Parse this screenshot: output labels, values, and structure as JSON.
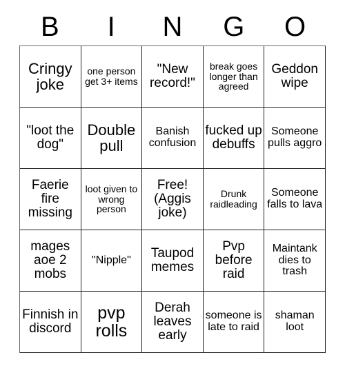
{
  "card": {
    "title": "BINGO",
    "headers": [
      "B",
      "I",
      "N",
      "G",
      "O"
    ],
    "rows": [
      [
        {
          "text": "Cringy joke",
          "size": "lg"
        },
        {
          "text": "one person get 3+ items",
          "size": "xs"
        },
        {
          "text": "\"New record!\"",
          "size": "md"
        },
        {
          "text": "break goes longer than agreed",
          "size": "xs"
        },
        {
          "text": "Geddon wipe",
          "size": "md"
        }
      ],
      [
        {
          "text": "\"loot the dog\"",
          "size": "md"
        },
        {
          "text": "Double pull",
          "size": "lg"
        },
        {
          "text": "Banish confusion",
          "size": "sm"
        },
        {
          "text": "fucked up debuffs",
          "size": "md"
        },
        {
          "text": "Someone pulls aggro",
          "size": "sm"
        }
      ],
      [
        {
          "text": "Faerie fire missing",
          "size": "md"
        },
        {
          "text": "loot given to wrong person",
          "size": "xs"
        },
        {
          "text": "Free! (Aggis joke)",
          "size": "md"
        },
        {
          "text": "Drunk raidleading",
          "size": "xs"
        },
        {
          "text": "Someone falls to lava",
          "size": "sm"
        }
      ],
      [
        {
          "text": "mages aoe 2 mobs",
          "size": "md"
        },
        {
          "text": "\"Nipple\"",
          "size": "sm"
        },
        {
          "text": "Taupod memes",
          "size": "md"
        },
        {
          "text": "Pvp before raid",
          "size": "md"
        },
        {
          "text": "Maintank dies to trash",
          "size": "sm"
        }
      ],
      [
        {
          "text": "Finnish in discord",
          "size": "md"
        },
        {
          "text": "pvp rolls",
          "size": "xl"
        },
        {
          "text": "Derah leaves early",
          "size": "md"
        },
        {
          "text": "someone is late to raid",
          "size": "sm"
        },
        {
          "text": "shaman loot",
          "size": "sm"
        }
      ]
    ]
  },
  "colors": {
    "background": "#ffffff",
    "text": "#000000",
    "grid_line": "#222222"
  }
}
